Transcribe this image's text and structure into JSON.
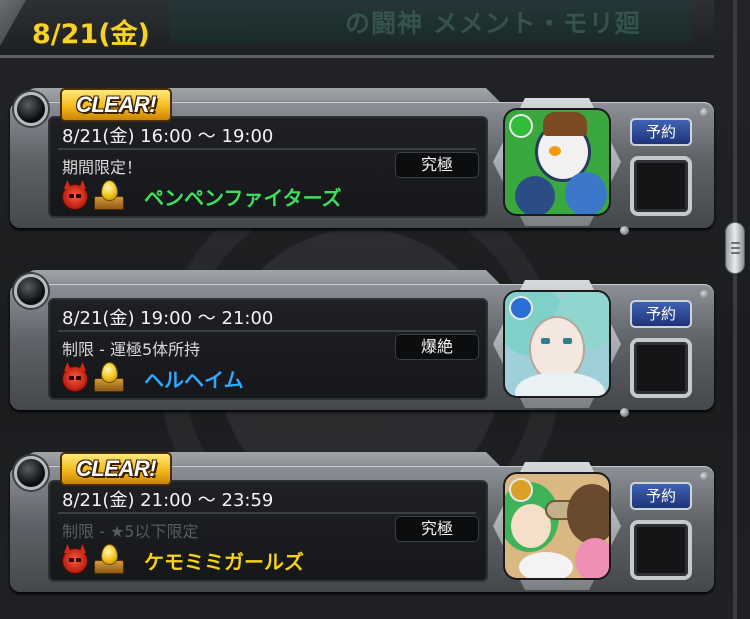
{
  "header": {
    "date": "8/21(金)",
    "banner_text": "の闘神 メメント・モリ廻"
  },
  "quests": [
    {
      "cleared": true,
      "badge_label": "CLEAR!",
      "time": "8/21(金) 16:00 ～ 19:00",
      "condition": "期間限定！",
      "condition_dimmed": false,
      "difficulty": "究極",
      "name": "ペンペンファイターズ",
      "name_color": "#3ce05a",
      "element_color": "#2fbd3a",
      "portrait_bg": "#3aa73f",
      "reserve_label": "予約"
    },
    {
      "cleared": false,
      "badge_label": "",
      "time": "8/21(金) 19:00 ～ 21:00",
      "condition": "制限 - 運極5体所持",
      "condition_dimmed": false,
      "difficulty": "爆絶",
      "name": "ヘルヘイム",
      "name_color": "#2fa9ff",
      "element_color": "#2a6fd6",
      "portrait_bg": "#9fcfd8",
      "reserve_label": "予約"
    },
    {
      "cleared": true,
      "badge_label": "CLEAR!",
      "time": "8/21(金) 21:00 ～ 23:59",
      "condition": "制限 - ★5以下限定",
      "condition_dimmed": true,
      "difficulty": "究極",
      "name": "ケモミミガールズ",
      "name_color": "#f5d118",
      "element_color": "#d9a227",
      "portrait_bg": "#d9b884",
      "reserve_label": "予約"
    }
  ],
  "icons": {
    "demon": "demon-face-icon",
    "treasure": "treasure-egg-icon",
    "knob": "dial-knob-icon",
    "scroll": "scroll-handle"
  }
}
